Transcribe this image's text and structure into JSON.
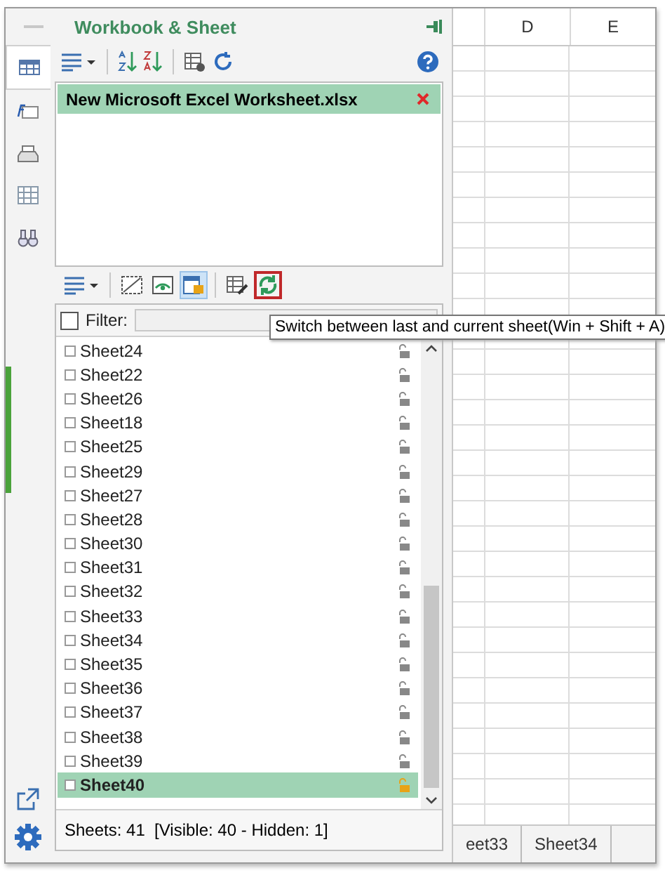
{
  "panel": {
    "title": "Workbook & Sheet"
  },
  "rail_tabs": [
    {
      "kind": "workbook",
      "selected": true
    },
    {
      "kind": "formula",
      "selected": false
    },
    {
      "kind": "print",
      "selected": false
    },
    {
      "kind": "grid",
      "selected": false
    },
    {
      "kind": "find",
      "selected": false
    }
  ],
  "workbooks": [
    {
      "name": "New Microsoft Excel Worksheet.xlsx",
      "selected": true
    }
  ],
  "sheet_tools": [
    {
      "kind": "menu",
      "on": false,
      "focused": false
    },
    {
      "kind": "hide",
      "on": false,
      "focused": false
    },
    {
      "kind": "show",
      "on": false,
      "focused": false
    },
    {
      "kind": "hidden",
      "on": true,
      "focused": false
    },
    {
      "kind": "edit",
      "on": false,
      "focused": false
    },
    {
      "kind": "switch",
      "on": false,
      "focused": true
    }
  ],
  "tooltip": "Switch between last and current sheet(Win + Shift + A)",
  "filter": {
    "label": "Filter:",
    "checked": false
  },
  "sheets": [
    {
      "name": "Sheet24",
      "selected": false
    },
    {
      "name": "Sheet22",
      "selected": false
    },
    {
      "name": "Sheet26",
      "selected": false
    },
    {
      "name": "Sheet18",
      "selected": false
    },
    {
      "name": "Sheet25",
      "selected": false
    },
    {
      "name": "Sheet29",
      "selected": false
    },
    {
      "name": "Sheet27",
      "selected": false
    },
    {
      "name": "Sheet28",
      "selected": false
    },
    {
      "name": "Sheet30",
      "selected": false
    },
    {
      "name": "Sheet31",
      "selected": false
    },
    {
      "name": "Sheet32",
      "selected": false
    },
    {
      "name": "Sheet33",
      "selected": false
    },
    {
      "name": "Sheet34",
      "selected": false
    },
    {
      "name": "Sheet35",
      "selected": false
    },
    {
      "name": "Sheet36",
      "selected": false
    },
    {
      "name": "Sheet37",
      "selected": false
    },
    {
      "name": "Sheet38",
      "selected": false
    },
    {
      "name": "Sheet39",
      "selected": false
    },
    {
      "name": "Sheet40",
      "selected": true
    }
  ],
  "status": "Sheets: 41  [Visible: 40 - Hidden: 1]",
  "grid": {
    "columns": [
      "D",
      "E"
    ],
    "tabs": [
      "eet33",
      "Sheet34"
    ]
  }
}
